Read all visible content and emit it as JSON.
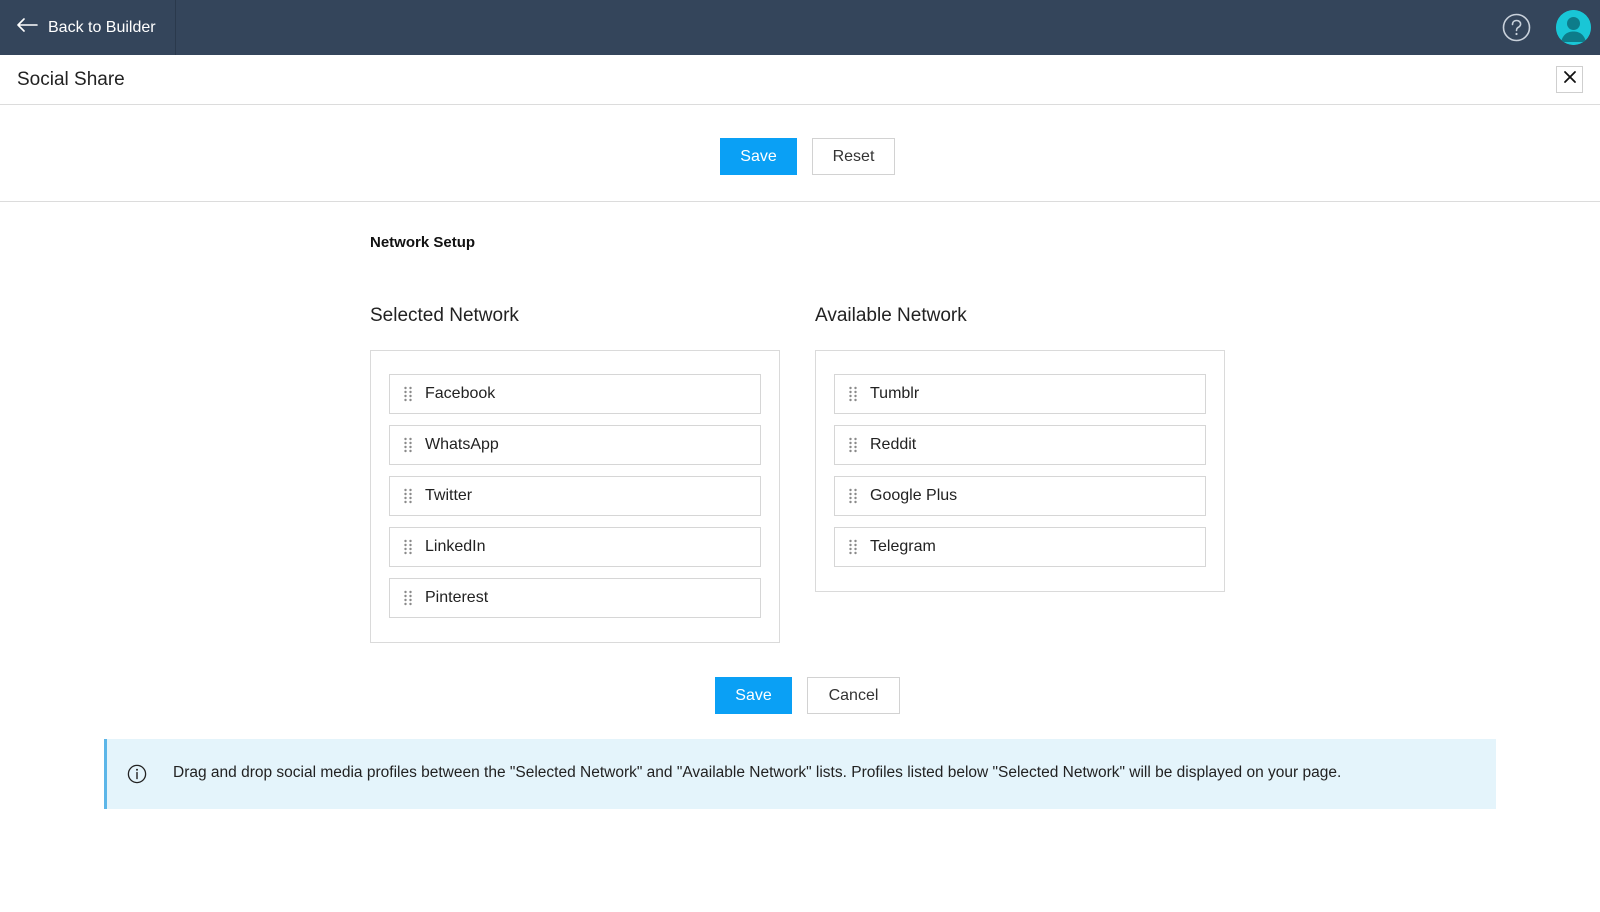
{
  "topbar": {
    "back_label": "Back to Builder",
    "avatar_color": "#19c6d6",
    "background": "#34455b"
  },
  "header": {
    "title": "Social Share"
  },
  "toolbar": {
    "save_label": "Save",
    "reset_label": "Reset"
  },
  "network_setup": {
    "section_title": "Network Setup",
    "selected_title": "Selected Network",
    "available_title": "Available Network",
    "selected_items": [
      {
        "label": "Facebook"
      },
      {
        "label": "WhatsApp"
      },
      {
        "label": "Twitter"
      },
      {
        "label": "LinkedIn"
      },
      {
        "label": "Pinterest"
      }
    ],
    "available_items": [
      {
        "label": "Tumblr"
      },
      {
        "label": "Reddit"
      },
      {
        "label": "Google Plus"
      },
      {
        "label": "Telegram"
      }
    ]
  },
  "footer_actions": {
    "save_label": "Save",
    "cancel_label": "Cancel"
  },
  "info": {
    "text": "Drag and drop social media profiles between the \"Selected Network\" and \"Available Network\" lists. Profiles listed below \"Selected Network\" will be displayed on your page."
  },
  "colors": {
    "primary": "#0aa0f5",
    "info_background": "#e4f4fb",
    "info_border": "#5cb6e8"
  },
  "icons": {
    "back": "arrow-left-icon",
    "help": "help-circle-icon",
    "avatar": "user-avatar-icon",
    "close": "close-icon",
    "drag": "drag-handle-icon",
    "info": "info-icon"
  }
}
